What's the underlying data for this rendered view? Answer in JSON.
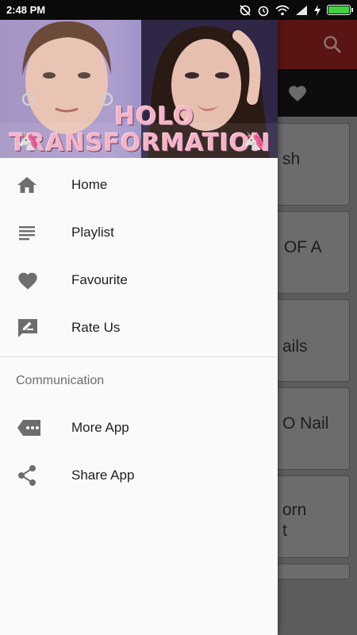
{
  "status_bar": {
    "time": "2:48 PM",
    "battery_level": 1.0
  },
  "header": {
    "title_line1": "HOLO",
    "title_line2": "TRANSFORMATION",
    "title_color": "#f4b3c6"
  },
  "menu": {
    "items": [
      {
        "label": "Home",
        "icon": "home-icon"
      },
      {
        "label": "Playlist",
        "icon": "playlist-icon"
      },
      {
        "label": "Favourite",
        "icon": "heart-icon"
      },
      {
        "label": "Rate Us",
        "icon": "rate-icon"
      }
    ],
    "section_title": "Communication",
    "communication_items": [
      {
        "label": "More App",
        "icon": "more-apps-icon"
      },
      {
        "label": "Share App",
        "icon": "share-icon"
      }
    ]
  },
  "background_list": {
    "cards": [
      {
        "text": "sh"
      },
      {
        "text": " OF A"
      },
      {
        "text": "ails"
      },
      {
        "text": "O Nail"
      },
      {
        "text": "orn\nt"
      },
      {
        "text": ""
      }
    ]
  },
  "colors": {
    "toolbar": "#5a1414",
    "icon_gray": "#6d6d6d",
    "drawer_bg": "#fafafa"
  }
}
